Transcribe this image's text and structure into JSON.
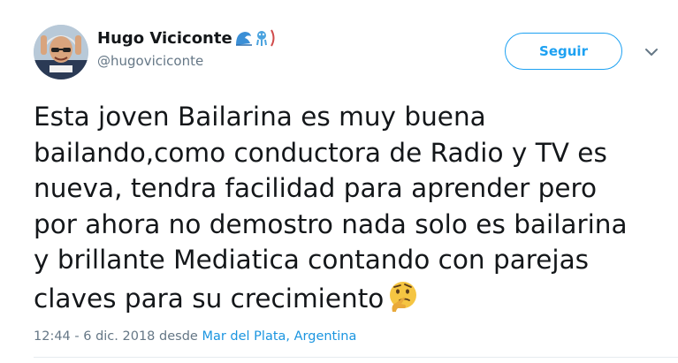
{
  "user": {
    "display_name": "Hugo Viciconte",
    "handle": "@hugoviciconte",
    "name_emojis": [
      "wave-emoji",
      "alien-emoji",
      "parenthesis-emoji"
    ]
  },
  "actions": {
    "follow_label": "Seguir",
    "caret_icon": "chevron-down-icon"
  },
  "tweet": {
    "lines": [
      "Esta joven Bailarina es muy buena",
      "bailando,como conductora de Radio y TV es",
      "nueva, tendra facilidad para aprender pero",
      "por ahora no demostro nada solo es bailarina",
      "y brillante Mediatica contando con parejas",
      "claves para su crecimiento"
    ],
    "trailing_emoji": "thinking-face-emoji"
  },
  "meta": {
    "timestamp": "12:44 - 6 dic. 2018",
    "from_label": "desde",
    "location": "Mar del Plata, Argentina"
  },
  "colors": {
    "accent": "#1da1f2",
    "link": "#1b95e0",
    "secondary_text": "#657786",
    "primary_text": "#14171a"
  }
}
